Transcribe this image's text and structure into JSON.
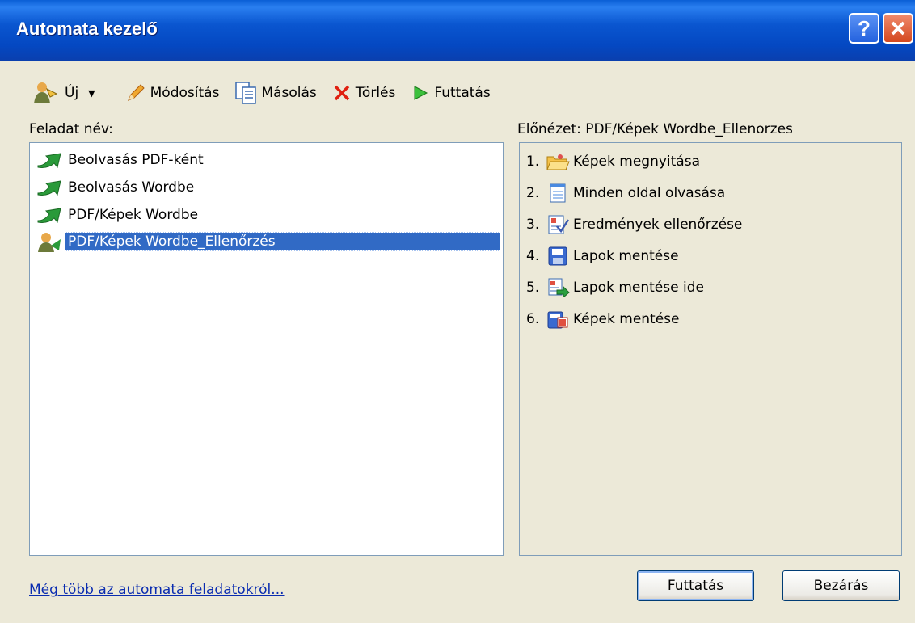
{
  "window": {
    "title": "Automata kezelő",
    "help_label": "?",
    "close_label": "✕"
  },
  "toolbar": {
    "new_label": "Új",
    "edit_label": "Módosítás",
    "copy_label": "Másolás",
    "delete_label": "Törlés",
    "run_label": "Futtatás"
  },
  "tasks": {
    "header": "Feladat név:",
    "items": [
      {
        "label": "Beolvasás PDF-ként",
        "icon": "task-arrow-icon"
      },
      {
        "label": "Beolvasás Wordbe",
        "icon": "task-arrow-icon"
      },
      {
        "label": "PDF/Képek Wordbe",
        "icon": "task-arrow-icon"
      },
      {
        "label": "PDF/Képek Wordbe_Ellenőrzés",
        "icon": "custom-task-icon",
        "selected": true
      }
    ]
  },
  "preview": {
    "header": "Előnézet: PDF/Képek Wordbe_Ellenorzes",
    "steps": [
      {
        "num": "1.",
        "label": "Képek megnyitása",
        "icon": "open-folder-icon"
      },
      {
        "num": "2.",
        "label": "Minden oldal olvasása",
        "icon": "read-page-icon"
      },
      {
        "num": "3.",
        "label": "Eredmények ellenőrzése",
        "icon": "verify-icon"
      },
      {
        "num": "4.",
        "label": "Lapok mentése",
        "icon": "save-disk-icon"
      },
      {
        "num": "5.",
        "label": "Lapok mentése ide",
        "icon": "save-to-icon"
      },
      {
        "num": "6.",
        "label": "Képek mentése",
        "icon": "save-images-icon"
      }
    ]
  },
  "footer": {
    "link_label": "Még több az automata feladatokról...",
    "run_button": "Futtatás",
    "close_button": "Bezárás"
  },
  "colors": {
    "title_bar": "#0a56d0",
    "selection": "#316ac5",
    "dialog_bg": "#ece9d8",
    "link": "#0a2cb0"
  }
}
